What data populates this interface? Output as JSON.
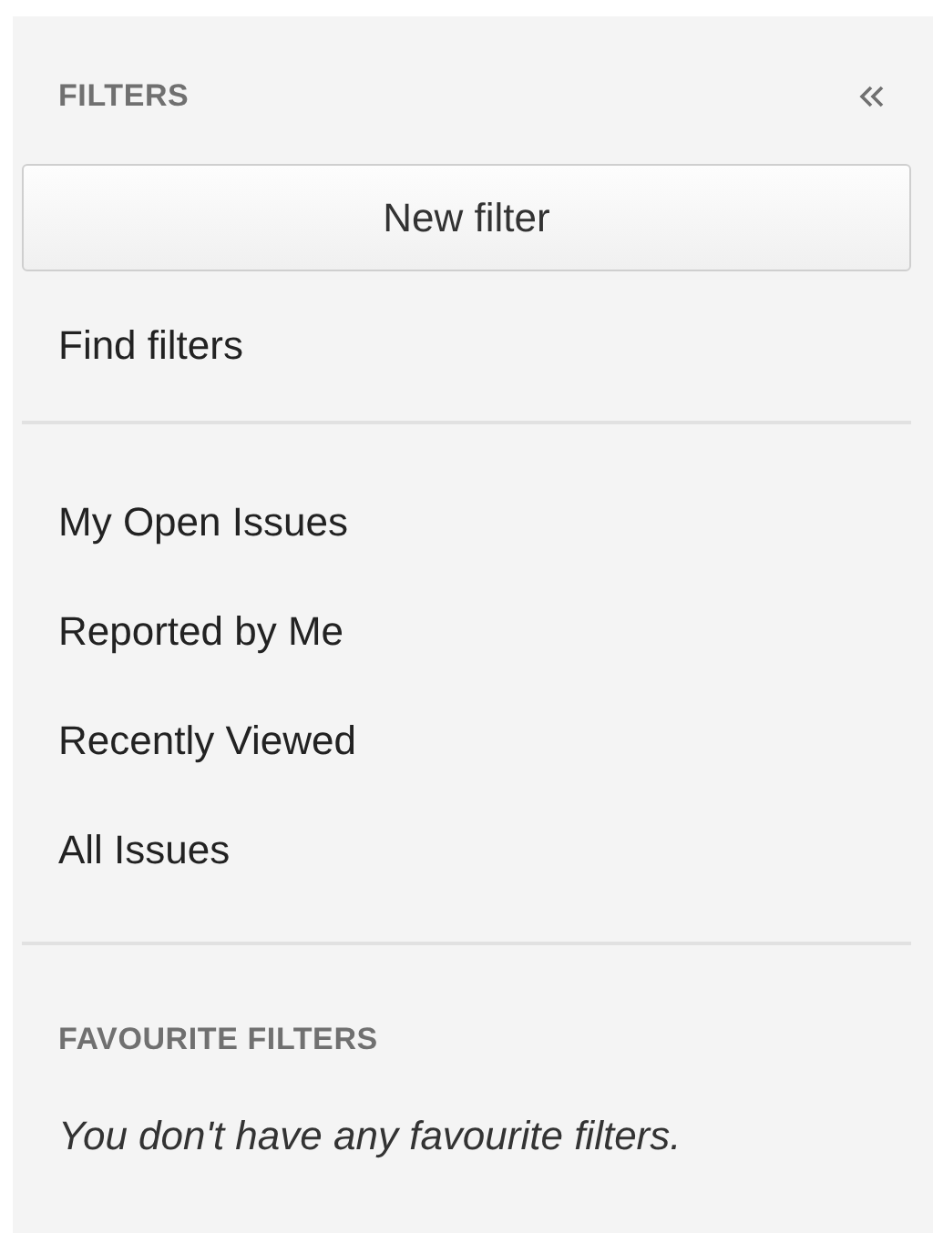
{
  "header": {
    "title": "FILTERS"
  },
  "new_filter_button": {
    "label": "New filter"
  },
  "find_filters": {
    "label": "Find filters"
  },
  "system_filters": [
    {
      "label": "My Open Issues"
    },
    {
      "label": "Reported by Me"
    },
    {
      "label": "Recently Viewed"
    },
    {
      "label": "All Issues"
    }
  ],
  "favourites": {
    "title": "FAVOURITE FILTERS",
    "empty_message": "You don't have any favourite filters."
  }
}
